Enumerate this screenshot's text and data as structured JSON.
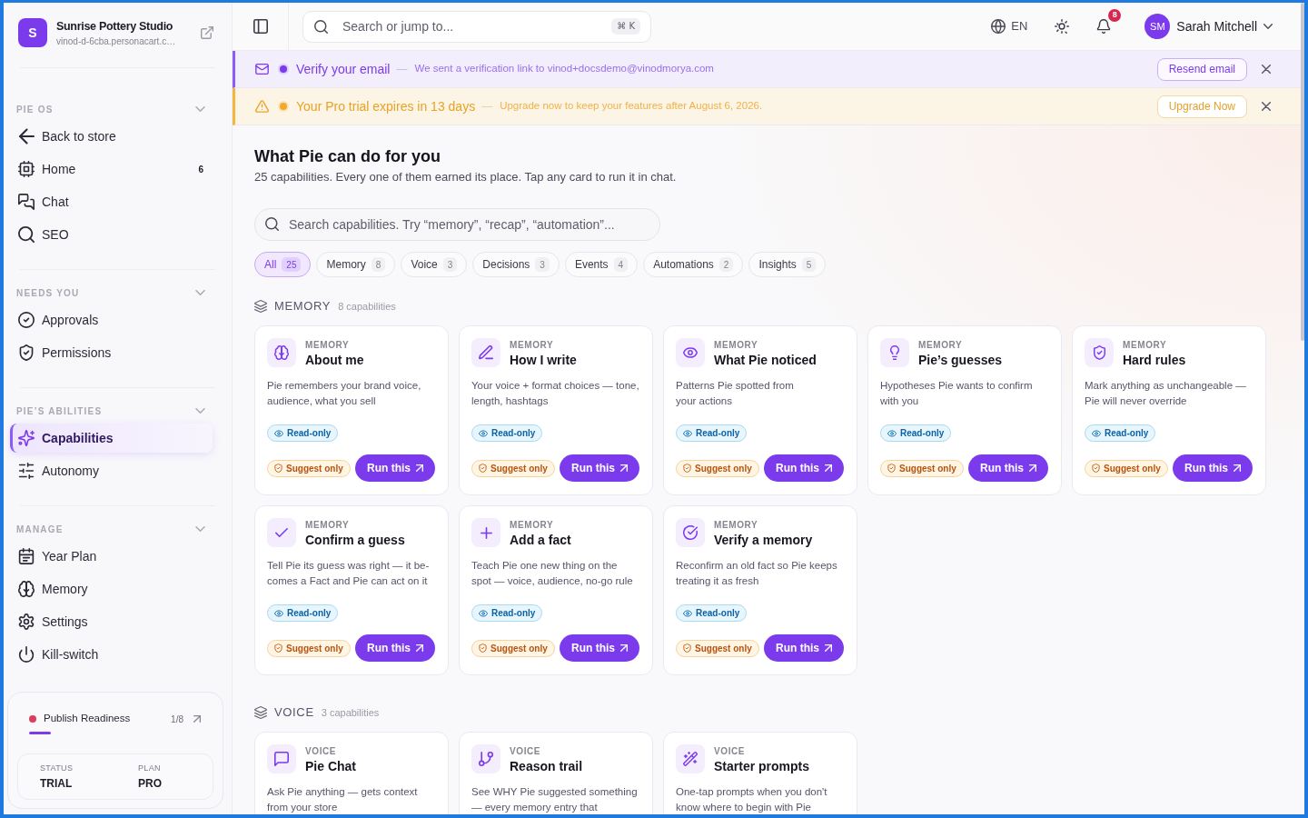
{
  "store": {
    "logo": "S",
    "name": "Sunrise Pottery Studio",
    "url": "vinod-d-6cba.personacart.c…"
  },
  "sidebar": {
    "sections": [
      {
        "title": "PIE OS",
        "expanded": true,
        "items": [
          {
            "label": "Back to store",
            "selected": false
          },
          {
            "label": "Home",
            "badge": "6",
            "selected": false
          },
          {
            "label": "Chat",
            "selected": false
          },
          {
            "label": "SEO",
            "selected": false
          }
        ]
      },
      {
        "title": "NEEDS YOU",
        "expanded": true,
        "items": [
          {
            "label": "Approvals",
            "selected": false
          },
          {
            "label": "Permissions",
            "selected": false
          }
        ]
      },
      {
        "title": "PIE’S ABILITIES",
        "expanded": true,
        "items": [
          {
            "label": "Capabilities",
            "selected": true
          },
          {
            "label": "Autonomy",
            "selected": false
          }
        ]
      },
      {
        "title": "MANAGE",
        "expanded": true,
        "items": [
          {
            "label": "Year Plan",
            "selected": false
          },
          {
            "label": "Memory",
            "selected": false
          },
          {
            "label": "Settings",
            "selected": false
          },
          {
            "label": "Kill-switch",
            "selected": false
          }
        ]
      }
    ],
    "readiness": {
      "label": "Publish Readiness",
      "count": "1/8",
      "level": 0.125
    },
    "plan": [
      {
        "label": "STATUS",
        "value": "TRIAL"
      },
      {
        "label": "PLAN",
        "value": "PRO"
      }
    ]
  },
  "topbar": {
    "search": {
      "placeholder": "Search or jump to...",
      "shortcut": "⌘ K"
    },
    "language": "EN",
    "notifications": "8",
    "user": {
      "initials": "SM",
      "name": "Sarah Mitchell"
    }
  },
  "banners": [
    {
      "kind": "info",
      "title": "Verify your email",
      "separator": "—",
      "message": "We sent a verification link to vinod+docsdemo@vinodmorya.com",
      "action": "Resend email"
    },
    {
      "kind": "warning",
      "title": "Your Pro trial expires in 13 days",
      "separator": "—",
      "message": "Upgrade now to keep your features after August 6, 2026.",
      "action": "Upgrade Now"
    }
  ],
  "page": {
    "title": "What Pie can do for you",
    "subtitle": "25 capabilities. Every one of them earned its place. Tap any card to run it in chat.",
    "search": {
      "placeholder": "Search capabilities. Try “memory”, “recap”, “automation”..."
    },
    "filters": [
      {
        "label": "All",
        "count": "25",
        "selected": true
      },
      {
        "label": "Memory",
        "count": "8",
        "selected": false
      },
      {
        "label": "Voice",
        "count": "3",
        "selected": false
      },
      {
        "label": "Decisions",
        "count": "3",
        "selected": false
      },
      {
        "label": "Events",
        "count": "4",
        "selected": false
      },
      {
        "label": "Automations",
        "count": "2",
        "selected": false
      },
      {
        "label": "Insights",
        "count": "5",
        "selected": false
      }
    ]
  },
  "sections": [
    {
      "title": "MEMORY",
      "count": "8 capabilities",
      "cards": [
        {
          "category": "MEMORY",
          "title": "About me",
          "description": "Pie remembers your brand voice, audience, what you sell",
          "access": "Read-only",
          "mode": "Suggest only",
          "action": "Run this"
        },
        {
          "category": "MEMORY",
          "title": "How I write",
          "description": "Your voice + format choices — tone, length, hashtags",
          "access": "Read-only",
          "mode": "Suggest only",
          "action": "Run this"
        },
        {
          "category": "MEMORY",
          "title": "What Pie noticed",
          "description": "Patterns Pie spotted from your actions",
          "access": "Read-only",
          "mode": "Suggest only",
          "action": "Run this"
        },
        {
          "category": "MEMORY",
          "title": "Pie’s guesses",
          "description": "Hypotheses Pie wants to confirm with you",
          "access": "Read-only",
          "mode": "Suggest only",
          "action": "Run this"
        },
        {
          "category": "MEMORY",
          "title": "Hard rules",
          "description": "Mark anything as unchangeable — Pie will never override",
          "access": "Read-only",
          "mode": "Suggest only",
          "action": "Run this"
        },
        {
          "category": "MEMORY",
          "title": "Confirm a guess",
          "description": "Tell Pie its guess was right — it be-comes a Fact and Pie can act on it",
          "access": "Read-only",
          "mode": "Suggest only",
          "action": "Run this"
        },
        {
          "category": "MEMORY",
          "title": "Add a fact",
          "description": "Teach Pie one new thing on the spot — voice, audience, no-go rule",
          "access": "Read-only",
          "mode": "Suggest only",
          "action": "Run this"
        },
        {
          "category": "MEMORY",
          "title": "Verify a memory",
          "description": "Reconfirm an old fact so Pie keeps treating it as fresh",
          "access": "Read-only",
          "mode": "Suggest only",
          "action": "Run this"
        }
      ]
    },
    {
      "title": "VOICE",
      "count": "3 capabilities",
      "cards": [
        {
          "category": "VOICE",
          "title": "Pie Chat",
          "description": "Ask Pie anything — gets context from your store"
        },
        {
          "category": "VOICE",
          "title": "Reason trail",
          "description": "See WHY Pie suggested something — every memory entry that"
        },
        {
          "category": "VOICE",
          "title": "Starter prompts",
          "description": "One-tap prompts when you don't know where to begin with Pie"
        }
      ]
    }
  ]
}
